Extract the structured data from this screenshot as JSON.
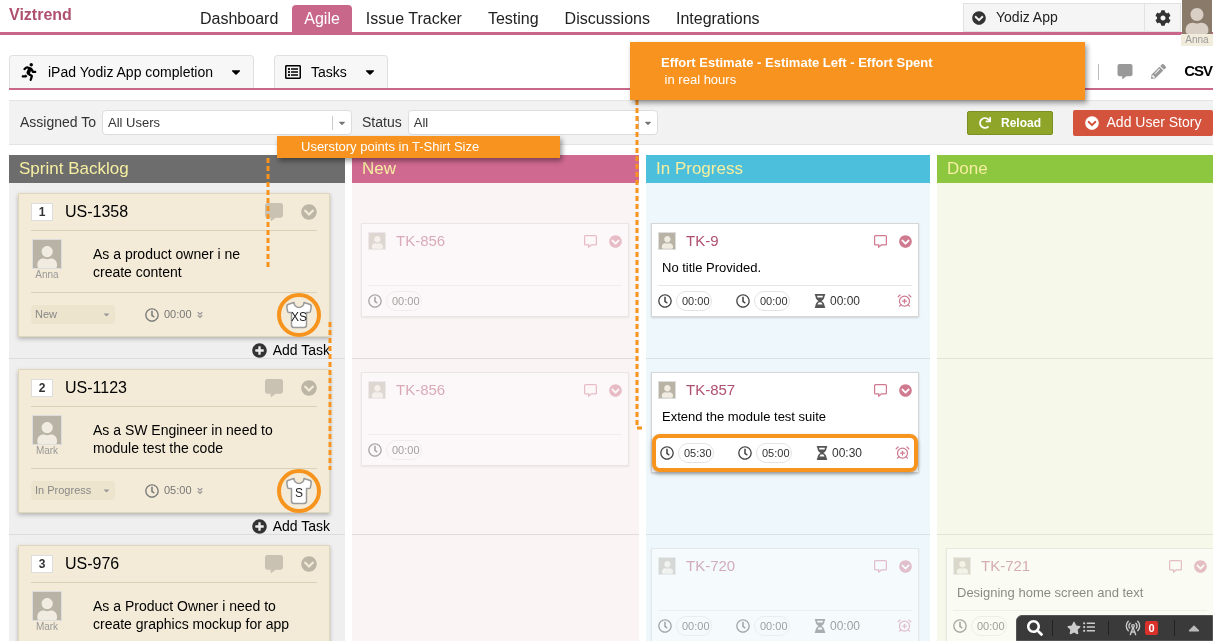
{
  "header": {
    "logo": "Viztrend",
    "project": "Yodiz App",
    "user": "Anna"
  },
  "nav_tabs": [
    {
      "label": "Dashboard",
      "selected": false
    },
    {
      "label": "Agile",
      "selected": true
    },
    {
      "label": "Issue Tracker",
      "selected": false
    },
    {
      "label": "Testing",
      "selected": false
    },
    {
      "label": "Discussions",
      "selected": false
    },
    {
      "label": "Integrations",
      "selected": false
    }
  ],
  "views": [
    {
      "label": "iPad Yodiz App completion",
      "kind": "sprint"
    },
    {
      "label": "Tasks",
      "kind": "board"
    }
  ],
  "tools": {
    "export": "CSV"
  },
  "filters": [
    {
      "label": "Assigned To",
      "value": "All Users"
    },
    {
      "label": "Status",
      "value": "All"
    }
  ],
  "actions": [
    {
      "label": "Reload",
      "kind": "reload"
    },
    {
      "label": "Add User Story",
      "kind": "add"
    }
  ],
  "columns": [
    {
      "title": "Sprint Backlog",
      "color": "#6d6d6d"
    },
    {
      "title": "New",
      "color": "#d0698f"
    },
    {
      "title": "In Progress",
      "color": "#4cbfdc"
    },
    {
      "title": "Done",
      "color": "#8dc63f"
    }
  ],
  "lanes": [
    {
      "story": {
        "rank": "1",
        "id": "US-1358",
        "owner": "Anna",
        "lines": [
          "As a product owner i ne",
          "create content"
        ],
        "status": "New",
        "estimate": "00:00",
        "size": "XS",
        "highlighted": true
      },
      "add_task": "Add Task",
      "new": {
        "id": "TK-856",
        "faded": true,
        "highlighted": false,
        "times": [
          {
            "kind": "estimate",
            "value": "00:00"
          }
        ]
      },
      "in_progress": {
        "id": "TK-9",
        "title": "No title Provided.",
        "faded": false,
        "highlighted": false,
        "times": [
          {
            "kind": "estimate",
            "value": "00:00"
          },
          {
            "kind": "left",
            "value": "00:00"
          },
          {
            "kind": "spent",
            "value": "00:00"
          }
        ]
      }
    },
    {
      "story": {
        "rank": "2",
        "id": "US-1123",
        "owner": "Mark",
        "lines": [
          "As a SW Engineer in need to",
          "module test the code"
        ],
        "status": "In Progress",
        "estimate": "05:00",
        "size": "S",
        "highlighted": true
      },
      "add_task": "Add Task",
      "new": {
        "id": "TK-856",
        "faded": true,
        "highlighted": false,
        "times": [
          {
            "kind": "estimate",
            "value": "00:00"
          }
        ]
      },
      "in_progress": {
        "id": "TK-857",
        "title": "Extend the module test suite",
        "faded": false,
        "highlighted": true,
        "times": [
          {
            "kind": "estimate",
            "value": "05:30"
          },
          {
            "kind": "left",
            "value": "05:00"
          },
          {
            "kind": "spent",
            "value": "00:30"
          }
        ]
      }
    },
    {
      "story": {
        "rank": "3",
        "id": "US-976",
        "owner": "Mark",
        "lines": [
          "As a Product Owner i need to",
          "create graphics mockup for app"
        ]
      },
      "in_progress": {
        "id": "TK-720",
        "faded": true,
        "highlighted": false,
        "times": [
          {
            "kind": "estimate",
            "value": "00:00"
          },
          {
            "kind": "left",
            "value": "00:00"
          },
          {
            "kind": "spent",
            "value": "00:00"
          }
        ]
      },
      "done": {
        "id": "TK-721",
        "title": "Designing home screen and text",
        "faded": true,
        "highlighted": false,
        "times": [
          {
            "kind": "estimate",
            "value": "00:00"
          }
        ]
      }
    }
  ],
  "callouts": [
    {
      "title": "Userstory points in T-Shirt Size"
    },
    {
      "title": "Effort Estimate - Estimate Left - Effort Spent",
      "text": " in real hours"
    }
  ],
  "dock": {
    "badge": "0"
  }
}
